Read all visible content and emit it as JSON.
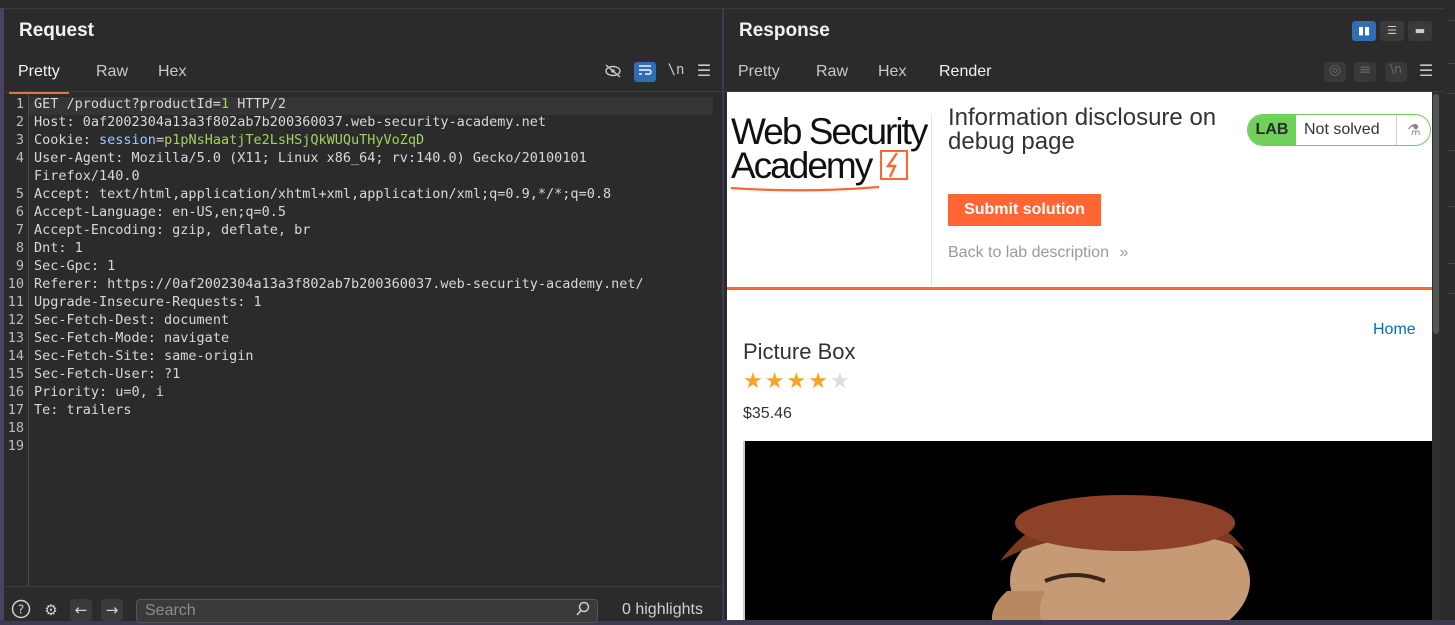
{
  "request": {
    "title": "Request",
    "tabs": [
      "Pretty",
      "Raw",
      "Hex"
    ],
    "newline_toggle": "\\n",
    "lines": [
      {
        "n": "1",
        "parts": [
          {
            "t": "GET /product?productId=",
            "c": "k"
          },
          {
            "t": "1",
            "c": "cv"
          },
          {
            "t": " HTTP/2",
            "c": "k"
          }
        ]
      },
      {
        "n": "2",
        "parts": [
          {
            "t": "Host: ",
            "c": "k"
          },
          {
            "t": "0af2002304a13a3f802ab7b200360037.web-security-academy.net",
            "c": "v"
          }
        ]
      },
      {
        "n": "3",
        "parts": [
          {
            "t": "Cookie: ",
            "c": "k"
          },
          {
            "t": "session",
            "c": "ck"
          },
          {
            "t": "=",
            "c": "k"
          },
          {
            "t": "p1pNsHaatjTe2LsHSjQkWUQuTHyVoZqD",
            "c": "cv"
          }
        ]
      },
      {
        "n": "4",
        "parts": [
          {
            "t": "User-Agent: ",
            "c": "k"
          },
          {
            "t": "Mozilla/5.0 (X11; Linux x86_64; rv:140.0) Gecko/20100101",
            "c": "v"
          }
        ]
      },
      {
        "n": "",
        "parts": [
          {
            "t": "Firefox/140.0",
            "c": "v"
          }
        ]
      },
      {
        "n": "5",
        "parts": [
          {
            "t": "Accept: ",
            "c": "k"
          },
          {
            "t": "text/html,application/xhtml+xml,application/xml;q=0.9,*/*;q=0.8",
            "c": "v"
          }
        ]
      },
      {
        "n": "6",
        "parts": [
          {
            "t": "Accept-Language: ",
            "c": "k"
          },
          {
            "t": "en-US,en;q=0.5",
            "c": "v"
          }
        ]
      },
      {
        "n": "7",
        "parts": [
          {
            "t": "Accept-Encoding: ",
            "c": "k"
          },
          {
            "t": "gzip, deflate, br",
            "c": "v"
          }
        ]
      },
      {
        "n": "8",
        "parts": [
          {
            "t": "Dnt: ",
            "c": "k"
          },
          {
            "t": "1",
            "c": "v"
          }
        ]
      },
      {
        "n": "9",
        "parts": [
          {
            "t": "Sec-Gpc: ",
            "c": "k"
          },
          {
            "t": "1",
            "c": "v"
          }
        ]
      },
      {
        "n": "10",
        "parts": [
          {
            "t": "Referer: ",
            "c": "k"
          },
          {
            "t": "https://0af2002304a13a3f802ab7b200360037.web-security-academy.net/",
            "c": "v"
          }
        ]
      },
      {
        "n": "11",
        "parts": [
          {
            "t": "Upgrade-Insecure-Requests: ",
            "c": "k"
          },
          {
            "t": "1",
            "c": "v"
          }
        ]
      },
      {
        "n": "12",
        "parts": [
          {
            "t": "Sec-Fetch-Dest: ",
            "c": "k"
          },
          {
            "t": "document",
            "c": "v"
          }
        ]
      },
      {
        "n": "13",
        "parts": [
          {
            "t": "Sec-Fetch-Mode: ",
            "c": "k"
          },
          {
            "t": "navigate",
            "c": "v"
          }
        ]
      },
      {
        "n": "14",
        "parts": [
          {
            "t": "Sec-Fetch-Site: ",
            "c": "k"
          },
          {
            "t": "same-origin",
            "c": "v"
          }
        ]
      },
      {
        "n": "15",
        "parts": [
          {
            "t": "Sec-Fetch-User: ",
            "c": "k"
          },
          {
            "t": "?1",
            "c": "v"
          }
        ]
      },
      {
        "n": "16",
        "parts": [
          {
            "t": "Priority: ",
            "c": "k"
          },
          {
            "t": "u=0, i",
            "c": "v"
          }
        ]
      },
      {
        "n": "17",
        "parts": [
          {
            "t": "Te: ",
            "c": "k"
          },
          {
            "t": "trailers",
            "c": "v"
          }
        ]
      },
      {
        "n": "18",
        "parts": []
      },
      {
        "n": "19",
        "parts": []
      }
    ],
    "search_placeholder": "Search",
    "highlights": "0 highlights"
  },
  "response": {
    "title": "Response",
    "tabs": [
      "Pretty",
      "Raw",
      "Hex",
      "Render"
    ],
    "active_tab": "Render",
    "render": {
      "logo_line1": "Web Security",
      "logo_line2": "Academy",
      "lab_title": "Information disclosure on debug page",
      "lab_badge": "LAB",
      "status": "Not solved",
      "submit": "Submit solution",
      "back": "Back to lab description",
      "home": "Home",
      "product_title": "Picture Box",
      "rating": 4,
      "rating_max": 5,
      "price": "$35.46"
    }
  },
  "colors": {
    "accent": "#e8743b",
    "brand_orange": "#ff6633",
    "lab_green": "#70d05c",
    "link_blue": "#0071bc",
    "wrap_blue": "#2f6db5"
  }
}
